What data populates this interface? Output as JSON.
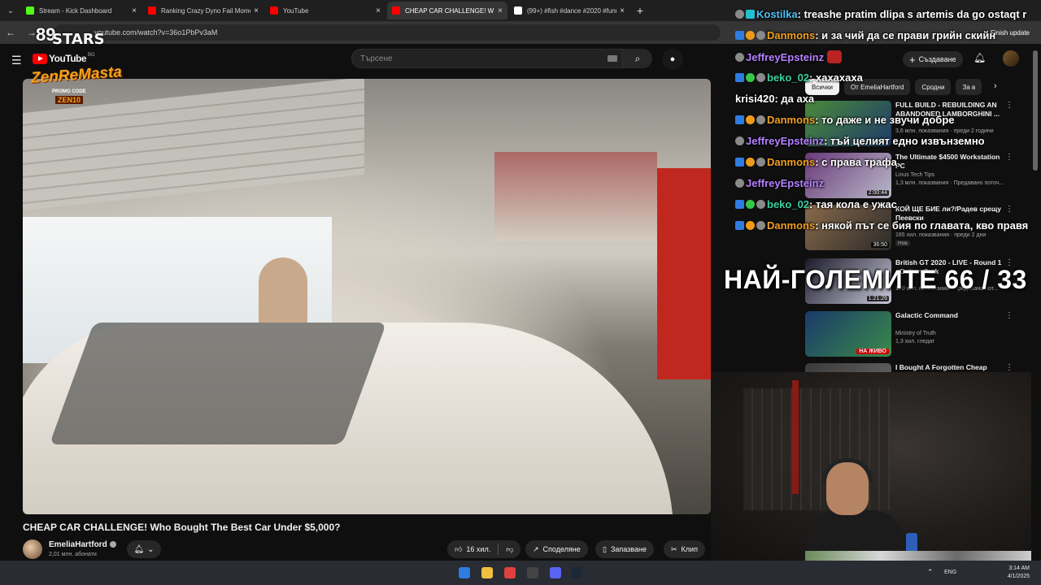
{
  "browser": {
    "tabs": [
      {
        "title": "Stream - Kick Dashboard",
        "color": "#53fc18"
      },
      {
        "title": "Ranking Crazy Dyno Fail Mome",
        "color": "#ff0000"
      },
      {
        "title": "YouTube",
        "color": "#ff0000"
      },
      {
        "title": "CHEAP CAR CHALLENGE! W",
        "color": "#ff0000",
        "active": true
      },
      {
        "title": "(99+) #fish #dance #2020 #funn",
        "color": "#ffffff"
      }
    ],
    "new_tab": "+",
    "url": "youtube.com/watch?v=36o1PbPv3aM",
    "finish_update": "Finish update"
  },
  "youtube": {
    "logo": "YouTube",
    "region": "BG",
    "search_placeholder": "Търсене",
    "create_label": "Създаване",
    "video_title": "CHEAP CAR CHALLENGE! Who Bought The Best Car Under $5,000?",
    "channel_name": "EmeliaHartford",
    "subscribers": "2,01 млн. абонати",
    "like_count": "16 хил.",
    "share_label": "Споделяне",
    "save_label": "Запазване",
    "clip_label": "Клип",
    "chips": [
      "Всички",
      "От EmeliaHartford",
      "Сродни",
      "За в"
    ],
    "recommendations": [
      {
        "title": "FULL BUILD - REBUILDING AN ABANDONED LAMBORGHINI ...",
        "channel": "",
        "meta": "3,6 млн. показвания · преди 2 години",
        "duration": "",
        "badge": "",
        "thumb": [
          "#4a8a3a",
          "#1f3a6a"
        ]
      },
      {
        "title": "The Ultimate $4500 Workstation PC",
        "channel": "Linus Tech Tips",
        "meta": "1,3 млн. показвания · Предавано поточ...",
        "duration": "2:00:44",
        "badge": "",
        "thumb": [
          "#6a3a7a",
          "#b8b8c8"
        ]
      },
      {
        "title": "КОЙ ЩЕ БИЕ ли?/Радев срещу Пеевски",
        "channel": "",
        "meta": "165 хил. показвания · преди 2 дни",
        "duration": "36:50",
        "badge": "Нов",
        "thumb": [
          "#8a6a4a",
          "#2a2a2a"
        ]
      },
      {
        "title": "British GT 2020 - LIVE - Round 1 - Oulton Park",
        "channel": "",
        "meta": "190 хил. показвания · Предавано пот...",
        "duration": "1:21:26",
        "badge": "",
        "thumb": [
          "#1a1a2a",
          "#c8c8d8"
        ]
      },
      {
        "title": "Galactic Command",
        "channel": "Ministry of Truth",
        "meta": "1,3 хил. гледат",
        "duration": "",
        "live": "НА ЖИВО",
        "badge": "",
        "thumb": [
          "#1a3a6a",
          "#3a8a4a"
        ]
      },
      {
        "title": "I Bought A Forgotten Cheap",
        "channel": "",
        "meta": "",
        "duration": "",
        "badge": "",
        "thumb": [
          "#3a3a3a",
          "#6a6a6a"
        ]
      }
    ]
  },
  "overlay": {
    "stars_number": "89",
    "stars_text": "STARS",
    "zen_text": "ZenReMasta",
    "promo_label": "PROMO CODE",
    "promo_code": "ZEN10",
    "big_text": "НАЙ-ГОЛЕМИТЕ 66 / 33"
  },
  "chat": [
    {
      "user": "Kostilka",
      "color": "#4fc3f7",
      "text": ": treashe pratim dlipa s artemis da go ostaqt r",
      "badges": [
        "b-gray",
        "b-cyan"
      ]
    },
    {
      "user": "Danmons",
      "color": "#f0a020",
      "text": ": и за чий да се прави грийн скийн",
      "badges": [
        "b-blue",
        "b-orange",
        "b-gray"
      ]
    },
    {
      "user": "JeffreyEpsteinz",
      "color": "#b580ff",
      "text": "",
      "badges": [
        "b-gray"
      ],
      "emote": true
    },
    {
      "user": "beko_02",
      "color": "#3ad0a0",
      "text": ": хахахаха",
      "badges": [
        "b-blue",
        "b-green",
        "b-gray"
      ]
    },
    {
      "user": "krisi420",
      "color": "#ffffff",
      "text": ": да аха",
      "badges": []
    },
    {
      "user": "Danmons",
      "color": "#f0a020",
      "text": ": то даже и не звучи добре",
      "badges": [
        "b-blue",
        "b-orange",
        "b-gray"
      ]
    },
    {
      "user": "JeffreyEpsteinz",
      "color": "#b580ff",
      "text": ": тъй целият едно извънземно",
      "badges": [
        "b-gray"
      ]
    },
    {
      "user": "Danmons",
      "color": "#f0a020",
      "text": ": с права трафа",
      "badges": [
        "b-blue",
        "b-orange",
        "b-gray"
      ]
    },
    {
      "user": "JeffreyEpsteinz",
      "color": "#b580ff",
      "text": "",
      "badges": [
        "b-gray"
      ]
    },
    {
      "user": "beko_02",
      "color": "#3ad0a0",
      "text": ": тая кола е ужас",
      "badges": [
        "b-blue",
        "b-green",
        "b-gray"
      ]
    },
    {
      "user": "Danmons",
      "color": "#f0a020",
      "text": ": някой път се бия по главата, кво правя",
      "badges": [
        "b-blue",
        "b-orange",
        "b-gray"
      ]
    }
  ],
  "taskbar": {
    "icons": [
      "windows-start",
      "file-explorer",
      "chrome",
      "obs",
      "discord",
      "steam"
    ],
    "icon_colors": [
      "#2f7ce0",
      "#f0c040",
      "#e04040",
      "#444444",
      "#5865f2",
      "#1b2838"
    ],
    "lang": "ENG",
    "time": "3:14 AM",
    "date": "4/1/2025"
  }
}
